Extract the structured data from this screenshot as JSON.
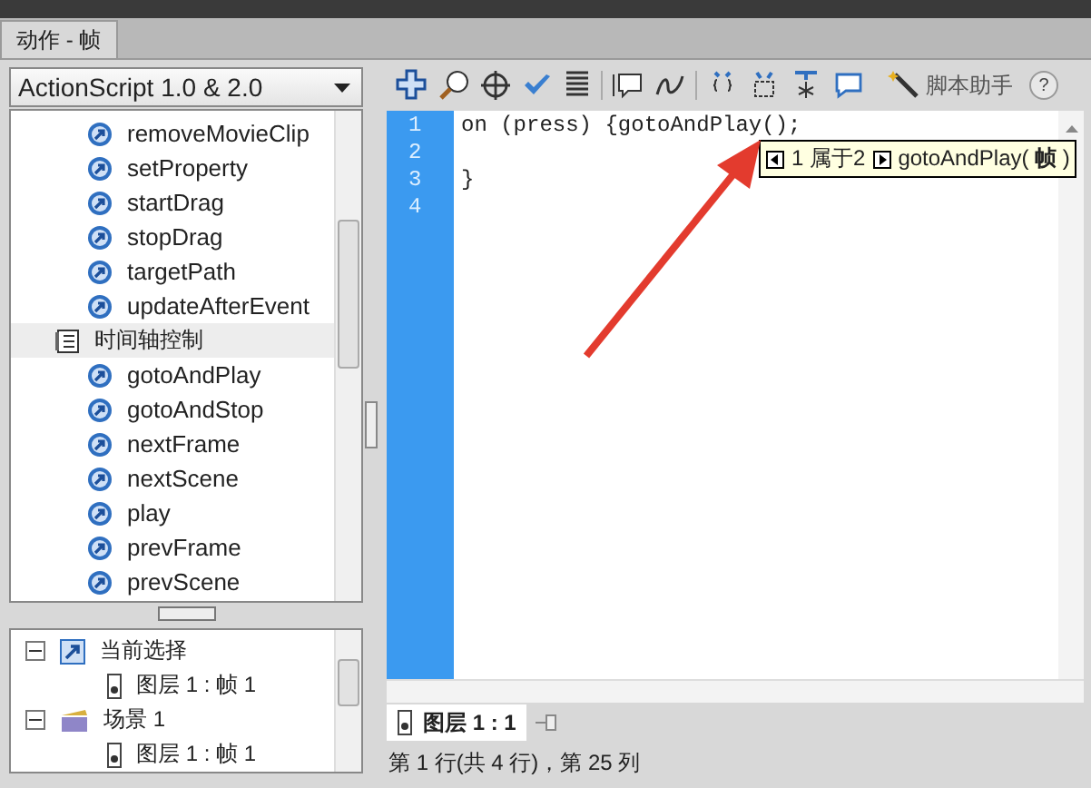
{
  "panel_tab": {
    "label": "动作 - 帧"
  },
  "language_dropdown": {
    "value": "ActionScript 1.0 & 2.0"
  },
  "actions_list": [
    {
      "kind": "action",
      "label": "removeMovieClip"
    },
    {
      "kind": "action",
      "label": "setProperty"
    },
    {
      "kind": "action",
      "label": "startDrag"
    },
    {
      "kind": "action",
      "label": "stopDrag"
    },
    {
      "kind": "action",
      "label": "targetPath"
    },
    {
      "kind": "action",
      "label": "updateAfterEvent"
    },
    {
      "kind": "folder",
      "label": "时间轴控制"
    },
    {
      "kind": "action",
      "label": "gotoAndPlay"
    },
    {
      "kind": "action",
      "label": "gotoAndStop"
    },
    {
      "kind": "action",
      "label": "nextFrame"
    },
    {
      "kind": "action",
      "label": "nextScene"
    },
    {
      "kind": "action",
      "label": "play"
    },
    {
      "kind": "action",
      "label": "prevFrame"
    },
    {
      "kind": "action",
      "label": "prevScene"
    }
  ],
  "script_navigator": [
    {
      "kind": "selection",
      "label": "当前选择",
      "expanded": true,
      "children": [
        {
          "label": "图层 1 : 帧 1"
        }
      ]
    },
    {
      "kind": "scene",
      "label": "场景 1",
      "expanded": true,
      "children": [
        {
          "label": "图层 1 : 帧 1"
        }
      ]
    }
  ],
  "toolbar": {
    "script_assist": "脚本助手",
    "help": "?"
  },
  "editor": {
    "lines": [
      {
        "number": "1",
        "code": "on (press) {gotoAndPlay();"
      },
      {
        "number": "2"
      },
      {
        "number": "3",
        "code": "}"
      },
      {
        "number": "4"
      }
    ],
    "code_hint": {
      "counter": "1 属于2",
      "signature": "gotoAndPlay( **帧** )"
    }
  },
  "script_tab": {
    "label": "图层 1 : 1"
  },
  "status_bar": "第 1 行(共 4 行)，第 25 列"
}
